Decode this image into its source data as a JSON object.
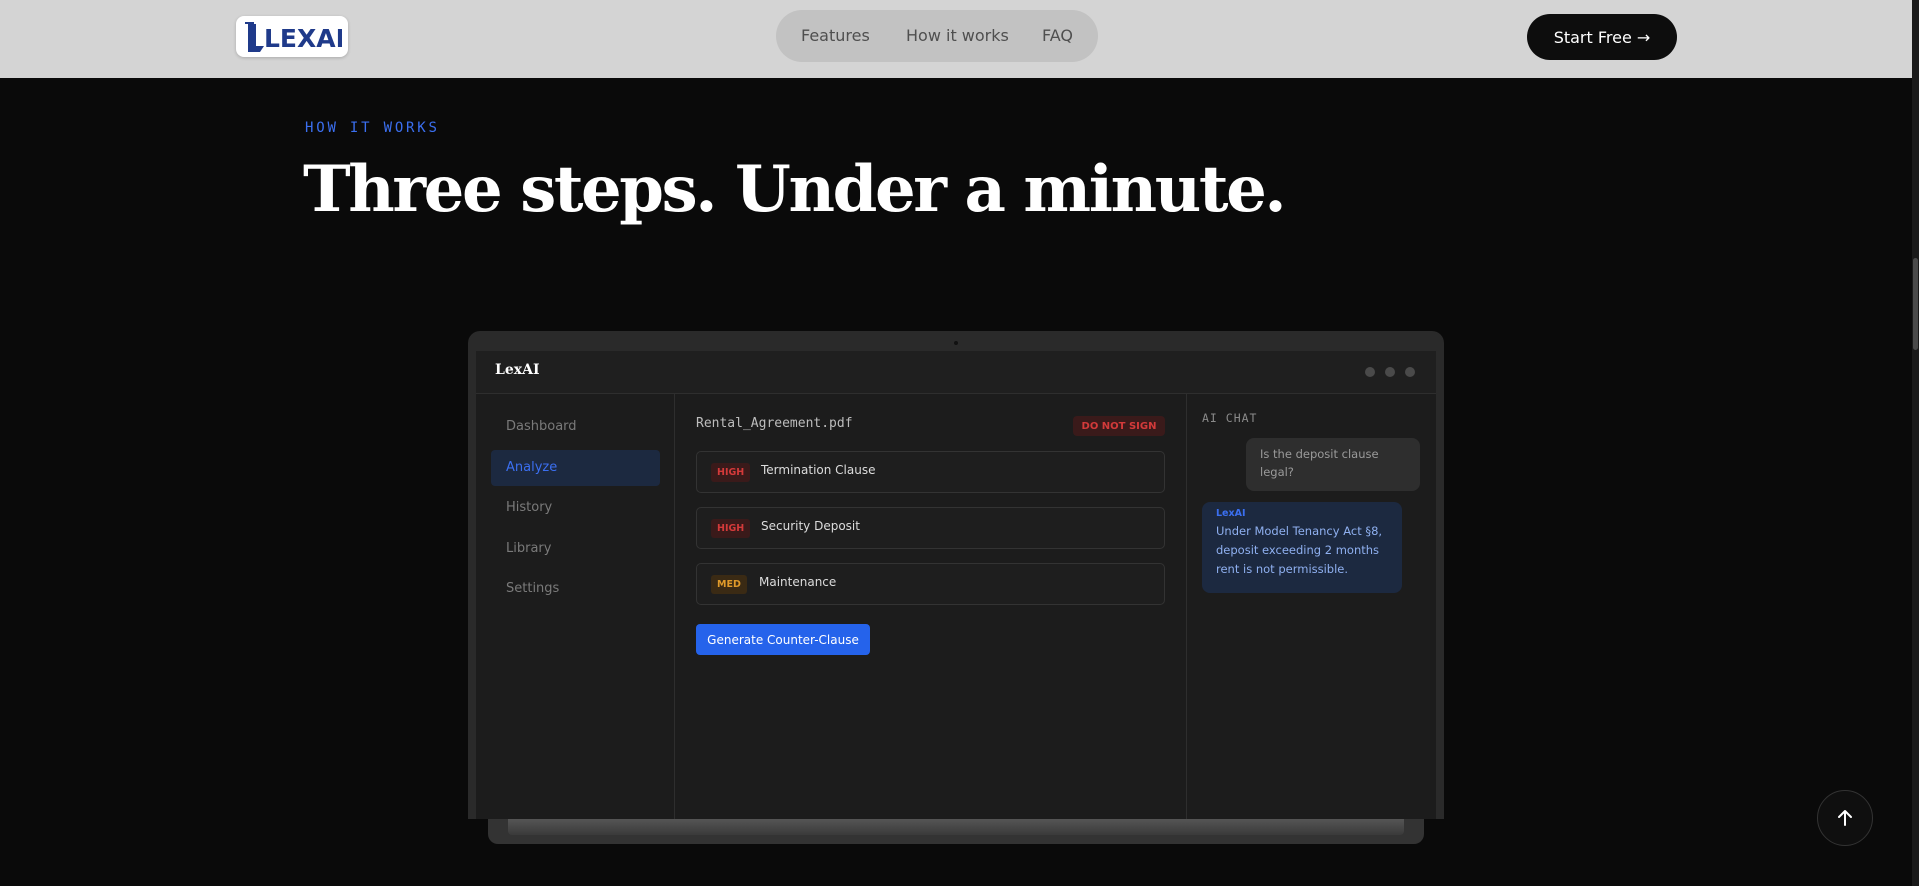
{
  "nav": {
    "logo_text": "LEXAI",
    "links": [
      "Features",
      "How it works",
      "FAQ"
    ],
    "cta": "Start Free →"
  },
  "section": {
    "eyebrow": "HOW IT WORKS",
    "headline": "Three steps. Under a minute."
  },
  "app": {
    "title": "LexAI",
    "sidebar": [
      {
        "label": "Dashboard",
        "active": false
      },
      {
        "label": "Analyze",
        "active": true
      },
      {
        "label": "History",
        "active": false
      },
      {
        "label": "Library",
        "active": false
      },
      {
        "label": "Settings",
        "active": false
      }
    ],
    "document": {
      "filename": "Rental_Agreement.pdf",
      "verdict": "DO NOT SIGN",
      "clauses": [
        {
          "severity": "HIGH",
          "label": "Termination Clause"
        },
        {
          "severity": "HIGH",
          "label": "Security Deposit"
        },
        {
          "severity": "MED",
          "label": "Maintenance"
        }
      ],
      "action_label": "Generate Counter-Clause"
    },
    "chat": {
      "title": "AI CHAT",
      "user_message": "Is the deposit clause legal?",
      "ai_name": "LexAI",
      "ai_message": "Under Model Tenancy Act §8, deposit exceeding 2 months rent is not permissible."
    }
  },
  "colors": {
    "accent": "#2563eb",
    "danger": "#d33a3a",
    "warning": "#e09a2a",
    "page_bg": "#0a0a0a",
    "nav_bg": "#d4d4d4"
  },
  "icons": {
    "scroll_top": "arrow-up-icon"
  }
}
